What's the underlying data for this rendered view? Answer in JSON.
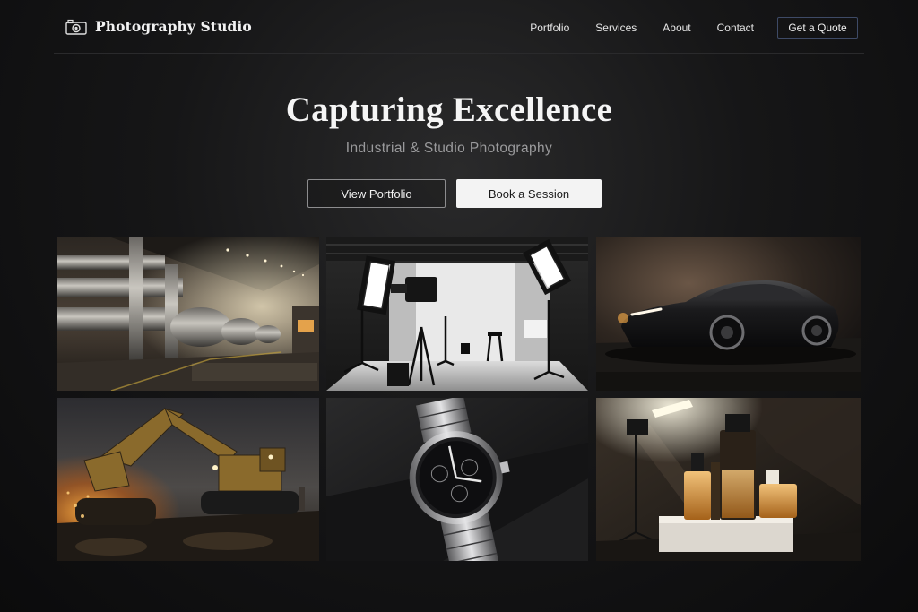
{
  "brand": {
    "name": "Photography Studio",
    "icon": "camera-icon"
  },
  "nav": {
    "links": [
      "Portfolio",
      "Services",
      "About",
      "Contact"
    ],
    "cta_label": "Get a Quote"
  },
  "hero": {
    "title": "Capturing Excellence",
    "subtitle": "Industrial & Studio Photography",
    "primary_label": "View Portfolio",
    "secondary_label": "Book a Session"
  },
  "colors": {
    "background": "#0d0d0e",
    "cta_border": "#3e4a66",
    "solid_button": "#f3f3f3",
    "accent_warm": "#e6a64a"
  }
}
